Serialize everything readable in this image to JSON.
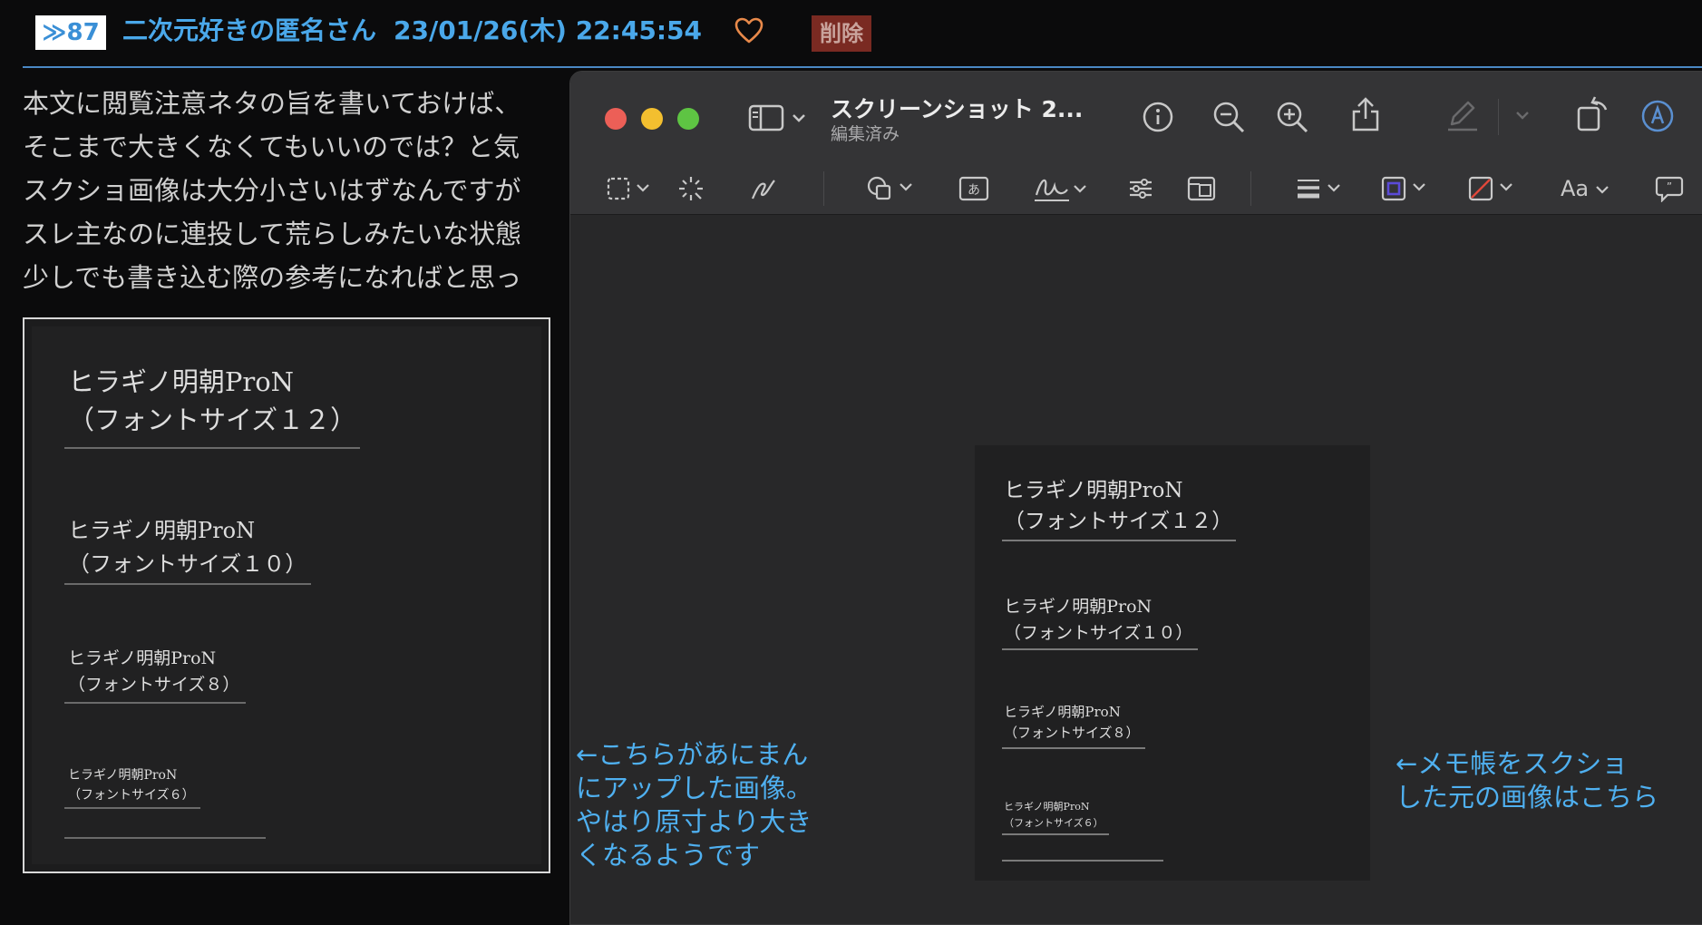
{
  "post": {
    "res_number": "≫87",
    "poster": "二次元好きの匿名さん",
    "date": "23/01/26(木) 22:45:54",
    "delete_label": "削除",
    "body_lines": [
      "本文に閲覧注意ネタの旨を書いておけば、",
      "そこまで大きくなくてもいいのでは？と気",
      "スクショ画像は大分小さいはずなんですが",
      "スレ主なのに連投して荒らしみたいな状態",
      "少しでも書き込む際の参考になればと思っ"
    ]
  },
  "samples": {
    "font_name": "ヒラギノ明朝ProN",
    "size12": "（フォントサイズ１２）",
    "size10": "（フォントサイズ１０）",
    "size8": "（フォントサイズ８）",
    "size6": "（フォントサイズ６）"
  },
  "window": {
    "title": "スクリーンショット 2...",
    "subtitle": "編集済み",
    "text_style_label": "Aa"
  },
  "annotations": {
    "left": [
      "←こちらがあにまん",
      "にアップした画像。",
      "やはり原寸より大き",
      "くなるようです"
    ],
    "right": [
      "←メモ帳をスクショ",
      "した元の画像はこちら"
    ]
  },
  "colors": {
    "link_blue": "#4aa8ea",
    "delete_bg": "#7a2a22",
    "heart": "#e8894a",
    "annotation_blue": "#4fb0f0"
  }
}
